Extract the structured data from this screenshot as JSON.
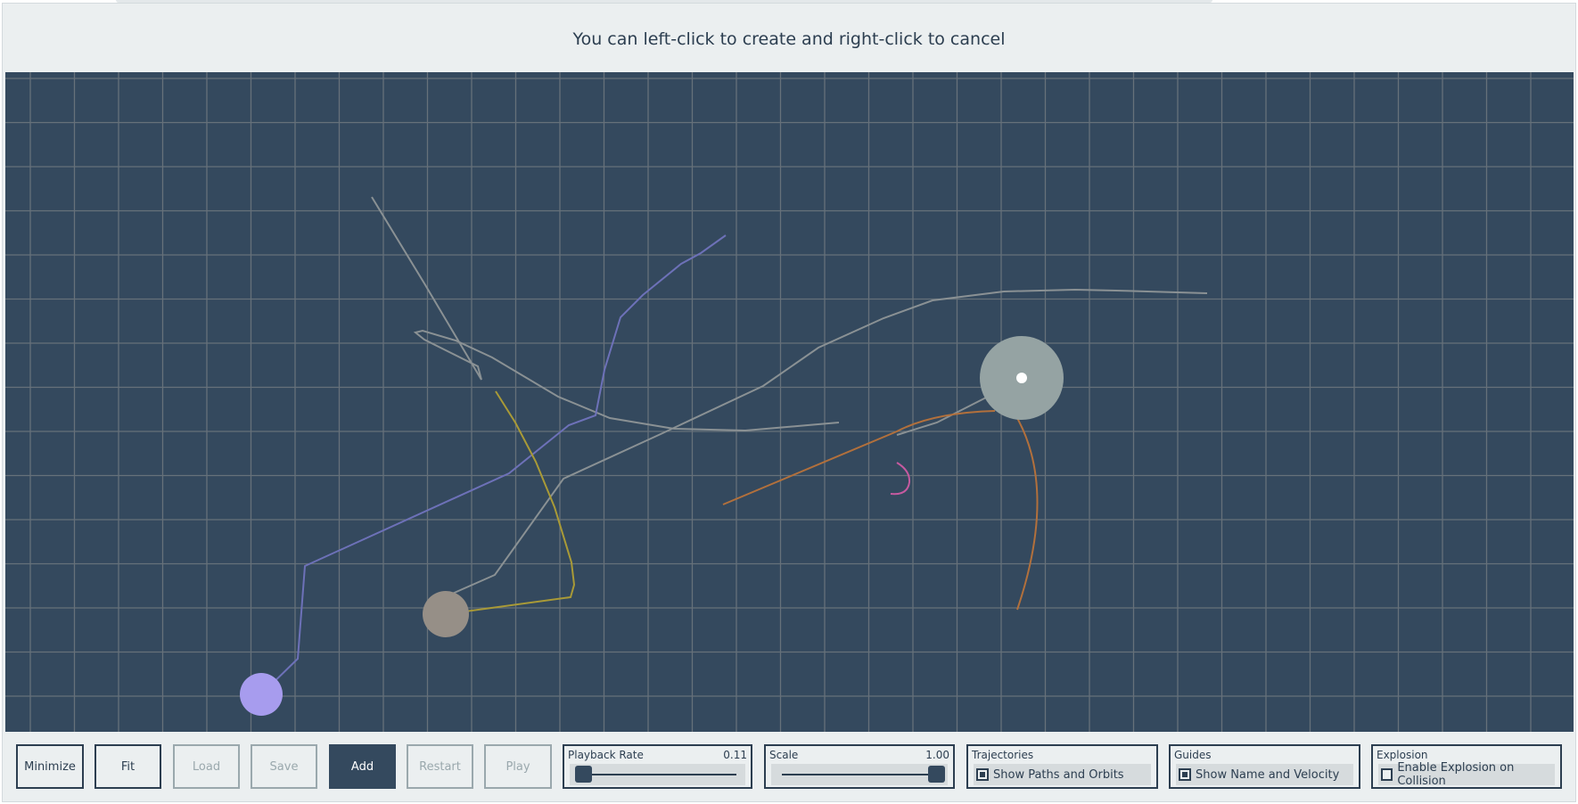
{
  "banner": {
    "text": "You can left-click to create and right-click to cancel"
  },
  "toolbar": {
    "minimize": "Minimize",
    "fit": "Fit",
    "load": "Load",
    "save": "Save",
    "add": "Add",
    "restart": "Restart",
    "play": "Play"
  },
  "playback": {
    "title": "Playback Rate",
    "value": "0.11",
    "level": 0.02
  },
  "scale": {
    "title": "Scale",
    "value": "1.00",
    "level": 1.0
  },
  "trajectories": {
    "title": "Trajectories",
    "label": "Show Paths and Orbits",
    "checked": true
  },
  "guides": {
    "title": "Guides",
    "label": "Show Name and Velocity",
    "checked": true
  },
  "explosion": {
    "title": "Explosion",
    "label": "Enable Explosion on Collision",
    "checked": false
  },
  "colors": {
    "canvas_bg": "#34495e",
    "grid": "#66717a",
    "accent": "#2c3e50",
    "body_purple": "#a79cee",
    "body_gray": "#968f87",
    "body_large": "#95a3a3",
    "path_purple": "#6d71b8",
    "path_yellow": "#a99a37",
    "path_gray": "#8a9194",
    "path_orange": "#b2703c",
    "path_pink": "#c65aa0"
  }
}
